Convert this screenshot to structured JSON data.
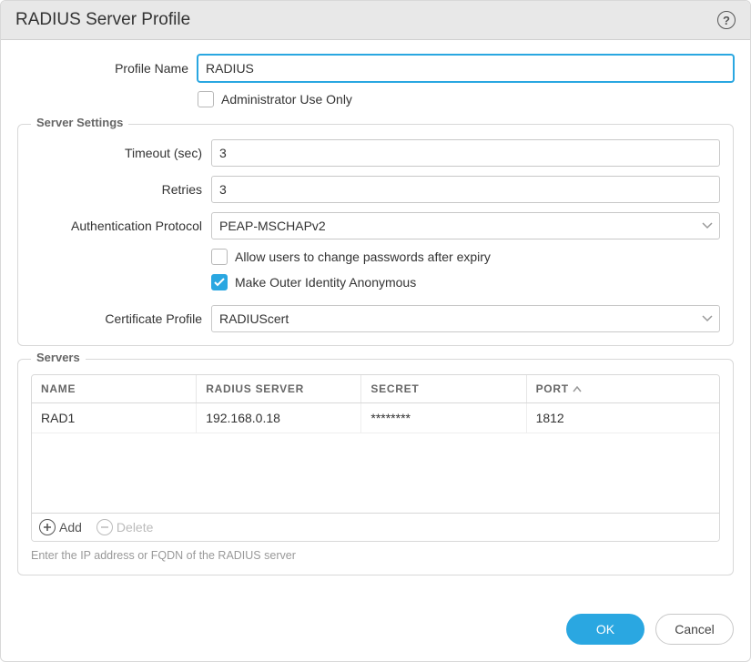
{
  "dialog": {
    "title": "RADIUS Server Profile"
  },
  "form": {
    "profile_name_label": "Profile Name",
    "profile_name_value": "RADIUS",
    "admin_only_label": "Administrator Use Only",
    "admin_only_checked": false
  },
  "server_settings": {
    "legend": "Server Settings",
    "timeout_label": "Timeout (sec)",
    "timeout_value": "3",
    "retries_label": "Retries",
    "retries_value": "3",
    "auth_protocol_label": "Authentication Protocol",
    "auth_protocol_value": "PEAP-MSCHAPv2",
    "allow_pw_change_label": "Allow users to change passwords after expiry",
    "allow_pw_change_checked": false,
    "anon_outer_label": "Make Outer Identity Anonymous",
    "anon_outer_checked": true,
    "cert_profile_label": "Certificate Profile",
    "cert_profile_value": "RADIUScert"
  },
  "servers": {
    "legend": "Servers",
    "columns": {
      "name": "NAME",
      "server": "RADIUS SERVER",
      "secret": "SECRET",
      "port": "PORT"
    },
    "sort_column": "port",
    "sort_dir": "asc",
    "rows": [
      {
        "name": "RAD1",
        "server": "192.168.0.18",
        "secret": "********",
        "port": "1812"
      }
    ],
    "add_label": "Add",
    "delete_label": "Delete",
    "hint": "Enter the IP address or FQDN of the RADIUS server"
  },
  "footer": {
    "ok_label": "OK",
    "cancel_label": "Cancel"
  }
}
